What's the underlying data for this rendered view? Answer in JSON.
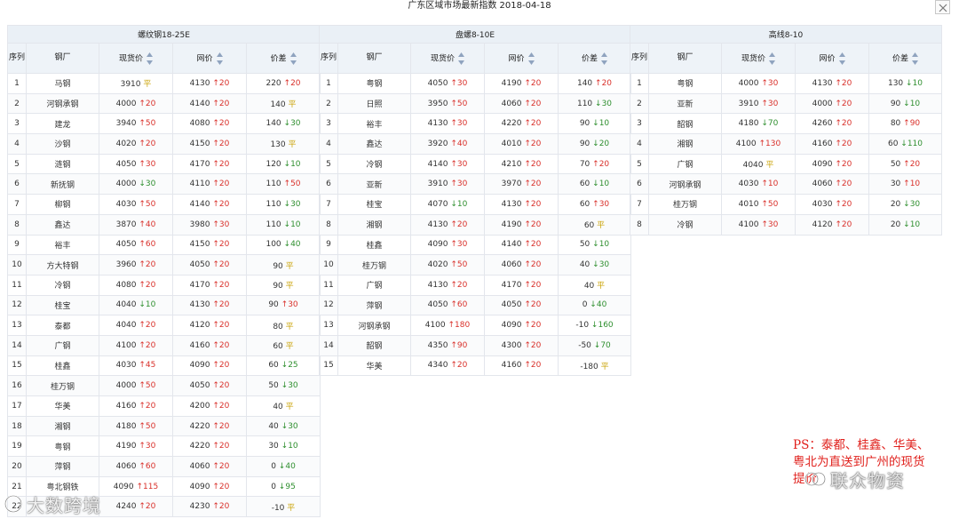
{
  "header": {
    "title": "广东区域市场最新指数 2018-04-18"
  },
  "columns": [
    "序列",
    "钢厂",
    "现货价",
    "网价",
    "价差"
  ],
  "groups": [
    {
      "title": "螺纹钢18-25E",
      "rows": [
        [
          "1",
          "马钢",
          "3910",
          "平",
          "4130",
          "↑20",
          "220",
          "↑20"
        ],
        [
          "2",
          "河钢承钢",
          "4000",
          "↑20",
          "4140",
          "↑20",
          "140",
          "平"
        ],
        [
          "3",
          "建龙",
          "3940",
          "↑50",
          "4080",
          "↑20",
          "140",
          "↓30"
        ],
        [
          "4",
          "沙钢",
          "4020",
          "↑20",
          "4150",
          "↑20",
          "130",
          "平"
        ],
        [
          "5",
          "涟钢",
          "4050",
          "↑30",
          "4170",
          "↑20",
          "120",
          "↓10"
        ],
        [
          "6",
          "新抚钢",
          "4000",
          "↓30",
          "4110",
          "↑20",
          "110",
          "↑50"
        ],
        [
          "7",
          "柳钢",
          "4030",
          "↑50",
          "4140",
          "↑20",
          "110",
          "↓30"
        ],
        [
          "8",
          "鑫达",
          "3870",
          "↑40",
          "3980",
          "↑30",
          "110",
          "↓10"
        ],
        [
          "9",
          "裕丰",
          "4050",
          "↑60",
          "4150",
          "↑20",
          "100",
          "↓40"
        ],
        [
          "10",
          "方大特钢",
          "3960",
          "↑20",
          "4050",
          "↑20",
          "90",
          "平"
        ],
        [
          "11",
          "冷钢",
          "4080",
          "↑20",
          "4170",
          "↑20",
          "90",
          "平"
        ],
        [
          "12",
          "桂宝",
          "4040",
          "↓10",
          "4130",
          "↑20",
          "90",
          "↑30"
        ],
        [
          "13",
          "泰都",
          "4040",
          "↑20",
          "4120",
          "↑20",
          "80",
          "平"
        ],
        [
          "14",
          "广钢",
          "4100",
          "↑20",
          "4160",
          "↑20",
          "60",
          "平"
        ],
        [
          "15",
          "桂鑫",
          "4030",
          "↑45",
          "4090",
          "↑20",
          "60",
          "↓25"
        ],
        [
          "16",
          "桂万钢",
          "4000",
          "↑50",
          "4050",
          "↑20",
          "50",
          "↓30"
        ],
        [
          "17",
          "华美",
          "4160",
          "↑20",
          "4200",
          "↑20",
          "40",
          "平"
        ],
        [
          "18",
          "湘钢",
          "4180",
          "↑50",
          "4220",
          "↑20",
          "40",
          "↓30"
        ],
        [
          "19",
          "粤钢",
          "4190",
          "↑30",
          "4220",
          "↑20",
          "30",
          "↓10"
        ],
        [
          "20",
          "萍钢",
          "4060",
          "↑60",
          "4060",
          "↑20",
          "0",
          "↓40"
        ],
        [
          "21",
          "粤北钢铁",
          "4090",
          "↑115",
          "4090",
          "↑20",
          "0",
          "↓95"
        ],
        [
          "22",
          "",
          "4240",
          "↑20",
          "4230",
          "↑20",
          "-10",
          "平"
        ]
      ]
    },
    {
      "title": "盘螺8-10E",
      "rows": [
        [
          "1",
          "粤钢",
          "4050",
          "↑30",
          "4190",
          "↑20",
          "140",
          "↑20"
        ],
        [
          "2",
          "日照",
          "3950",
          "↑50",
          "4060",
          "↑20",
          "110",
          "↓30"
        ],
        [
          "3",
          "裕丰",
          "4130",
          "↑30",
          "4220",
          "↑20",
          "90",
          "↓10"
        ],
        [
          "4",
          "鑫达",
          "3920",
          "↑40",
          "4010",
          "↑20",
          "90",
          "↓20"
        ],
        [
          "5",
          "冷钢",
          "4140",
          "↑30",
          "4210",
          "↑20",
          "70",
          "↑20"
        ],
        [
          "6",
          "亚新",
          "3910",
          "↑30",
          "3970",
          "↑20",
          "60",
          "↓10"
        ],
        [
          "7",
          "桂宝",
          "4070",
          "↓10",
          "4130",
          "↑20",
          "60",
          "↑30"
        ],
        [
          "8",
          "湘钢",
          "4130",
          "↑20",
          "4190",
          "↑20",
          "60",
          "平"
        ],
        [
          "9",
          "桂鑫",
          "4090",
          "↑30",
          "4140",
          "↑20",
          "50",
          "↓10"
        ],
        [
          "10",
          "桂万钢",
          "4020",
          "↑50",
          "4060",
          "↑20",
          "40",
          "↓30"
        ],
        [
          "11",
          "广钢",
          "4130",
          "↑20",
          "4170",
          "↑20",
          "40",
          "平"
        ],
        [
          "12",
          "萍钢",
          "4050",
          "↑60",
          "4050",
          "↑20",
          "0",
          "↓40"
        ],
        [
          "13",
          "河钢承钢",
          "4100",
          "↑180",
          "4090",
          "↑20",
          "-10",
          "↓160"
        ],
        [
          "14",
          "韶钢",
          "4350",
          "↑90",
          "4300",
          "↑20",
          "-50",
          "↓70"
        ],
        [
          "15",
          "华美",
          "4340",
          "↑20",
          "4160",
          "↑20",
          "-180",
          "平"
        ]
      ]
    },
    {
      "title": "高线8-10",
      "rows": [
        [
          "1",
          "粤钢",
          "4000",
          "↑30",
          "4130",
          "↑20",
          "130",
          "↓10"
        ],
        [
          "2",
          "亚新",
          "3910",
          "↑30",
          "4000",
          "↑20",
          "90",
          "↓10"
        ],
        [
          "3",
          "韶钢",
          "4180",
          "↓70",
          "4260",
          "↑20",
          "80",
          "↑90"
        ],
        [
          "4",
          "湘钢",
          "4100",
          "↑130",
          "4160",
          "↑20",
          "60",
          "↓110"
        ],
        [
          "5",
          "广钢",
          "4040",
          "平",
          "4090",
          "↑20",
          "50",
          "↑20"
        ],
        [
          "6",
          "河钢承钢",
          "4030",
          "↑10",
          "4060",
          "↑20",
          "30",
          "↑10"
        ],
        [
          "7",
          "桂万钢",
          "4010",
          "↑50",
          "4030",
          "↑20",
          "20",
          "↓30"
        ],
        [
          "8",
          "冷钢",
          "4100",
          "↑30",
          "4120",
          "↑20",
          "20",
          "↓10"
        ]
      ]
    }
  ],
  "note": {
    "lines": [
      "PS：泰都、桂鑫、华美、",
      "粤北为直送到广州的现货",
      "提价"
    ]
  },
  "watermarks": {
    "left": "大数跨境",
    "right": "联众物资"
  },
  "icons": {
    "close": "close-icon",
    "sort": "sort-icon",
    "watermark": "circle-logo-icon"
  },
  "colors": {
    "up": "#d9302a",
    "down": "#2f8f2f",
    "flat": "#c9a100",
    "header_bg": "#eaf0f6"
  }
}
